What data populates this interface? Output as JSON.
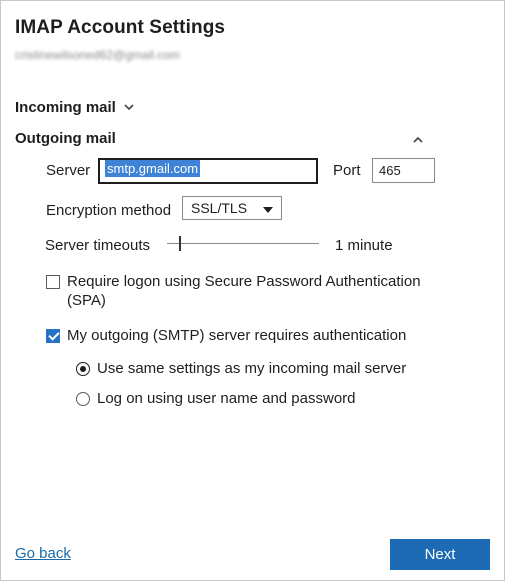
{
  "dialog": {
    "title": "IMAP Account Settings",
    "email": "cristinewilsoned62@gmail.com"
  },
  "incoming": {
    "label": "Incoming mail",
    "expanded": false
  },
  "outgoing": {
    "label": "Outgoing mail",
    "expanded": true,
    "server_label": "Server",
    "server_value": "smtp.gmail.com",
    "port_label": "Port",
    "port_value": "465",
    "encryption_label": "Encryption method",
    "encryption_value": "SSL/TLS",
    "timeout_label": "Server timeouts",
    "timeout_value": "1 minute",
    "timeout_slider_fraction": 0.08,
    "spa_label": "Require logon using Secure Password Authentication (SPA)",
    "spa_checked": false,
    "auth_label": "My outgoing (SMTP) server requires authentication",
    "auth_checked": true,
    "auth_options": [
      {
        "label": "Use same settings as my incoming mail server",
        "selected": true
      },
      {
        "label": "Log on using user name and password",
        "selected": false
      }
    ]
  },
  "footer": {
    "go_back_label": "Go back",
    "next_label": "Next"
  },
  "colors": {
    "accent": "#1d6bb5",
    "link": "#1a6aa8",
    "selection": "#3f83d7"
  },
  "icons": {
    "incoming_toggle": "chevron-down-icon",
    "outgoing_toggle": "chevron-up-icon",
    "encryption_dropdown": "caret-down-icon"
  }
}
